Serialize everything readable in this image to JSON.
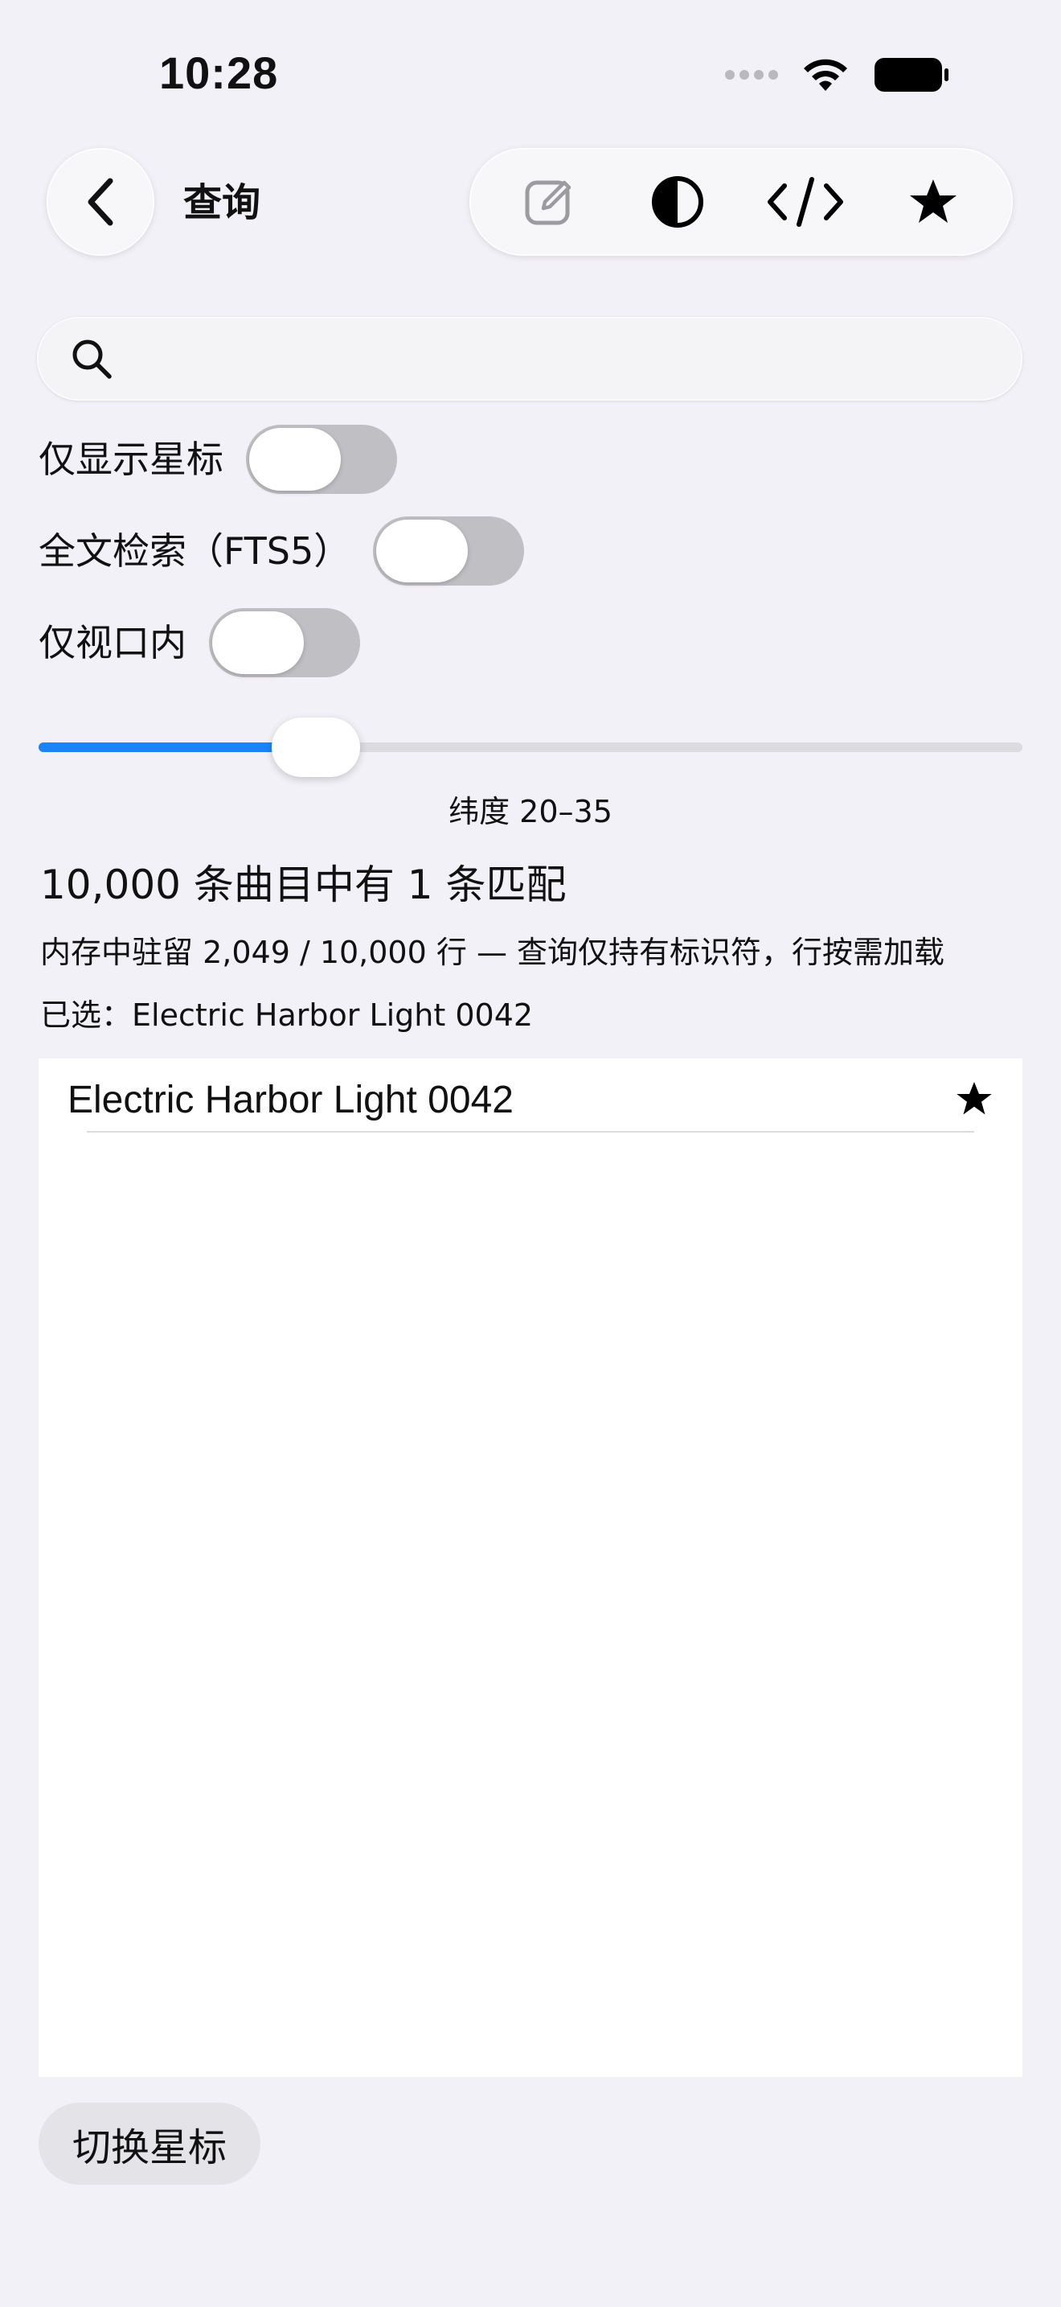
{
  "status_bar": {
    "time": "10:28"
  },
  "nav": {
    "title": "查询"
  },
  "toolbar": {
    "icons": [
      "edit-icon",
      "contrast-icon",
      "code-icon",
      "star-icon"
    ]
  },
  "search": {
    "value": "",
    "placeholder": ""
  },
  "filters": {
    "starred_only": {
      "label": "仅显示星标",
      "on": false
    },
    "full_text": {
      "label": "全文检索（FTS5）",
      "on": false
    },
    "viewport_only": {
      "label": "仅视口内",
      "on": false
    }
  },
  "slider": {
    "value": 0.26,
    "label": "纬度 20–35"
  },
  "summary": {
    "match_text": "10,000 条曲目中有 1 条匹配",
    "memory_text": "内存中驻留 2,049 / 10,000 行 — 查询仅持有标识符，行按需加载",
    "selected_text": "已选：Electric Harbor Light 0042"
  },
  "results": [
    {
      "title": "Electric Harbor Light 0042",
      "starred": true
    }
  ],
  "actions": {
    "toggle_star_label": "切换星标"
  },
  "colors": {
    "background": "#f2f1f7",
    "accent": "#1a84ff",
    "switch_off": "#bfbfc4"
  }
}
